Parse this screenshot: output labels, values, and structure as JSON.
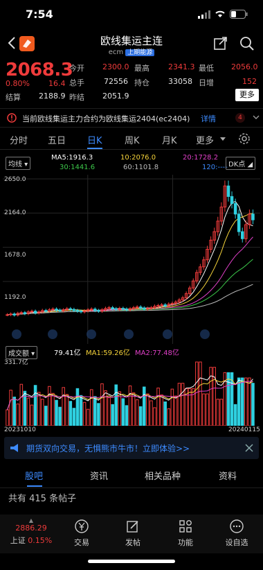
{
  "status": {
    "time": "7:54"
  },
  "header": {
    "title": "欧线集运主连",
    "code": "ecm",
    "exchange": "上期能源"
  },
  "quote": {
    "price": "2068.3",
    "change_pct": "0.80%",
    "change": "16.4",
    "open_label": "今开",
    "open": "2300.0",
    "high_label": "最高",
    "high": "2341.3",
    "low_label": "最低",
    "low": "2056.0",
    "volume_label": "总手",
    "volume": "72556",
    "oi_label": "持仓",
    "oi": "33058",
    "daily_add_label": "日增",
    "daily_add": "152",
    "settle_label": "结算",
    "settle": "2188.9",
    "prev_label": "昨结",
    "prev": "2051.9",
    "more_label": "更多"
  },
  "notice": {
    "text": "当前欧线集运主力合约为欧线集运2404(ec2404)",
    "link": "详情",
    "badge": "4"
  },
  "period_tabs": [
    "分时",
    "五日",
    "日K",
    "周K",
    "月K",
    "更多"
  ],
  "active_tab": "日K",
  "indicators": {
    "ma_select": "均线",
    "ma5": "MA5:1916.3",
    "ma10": "10:2076.0",
    "ma20": "20:1728.2",
    "ma30": "30:1441.6",
    "ma60": "60:1101.8",
    "ma120": "120:----",
    "dk": "DK点"
  },
  "price_axis": [
    "2650.0",
    "2164.0",
    "1678.0",
    "1192.0"
  ],
  "volume_header": {
    "select": "成交额",
    "val": "79.41亿",
    "ma1": "MA1:59.26亿",
    "ma2": "MA2:77.48亿",
    "max": "331.7亿"
  },
  "dates": {
    "start": "20231010",
    "end": "20240115"
  },
  "promo": {
    "text": "期货双向交易，无惧熊市牛市！立即体验>>"
  },
  "bottom_tabs": [
    "股吧",
    "资讯",
    "相关品种",
    "资料"
  ],
  "posts": {
    "text": "共有 415 条帖子"
  },
  "index": {
    "value": "2886.29",
    "name": "上证",
    "pct": "0.15%"
  },
  "nav": [
    "交易",
    "发帖",
    "功能",
    "设自选"
  ],
  "colors": {
    "up": "#ef3b3b",
    "down": "#2fd0e0",
    "accent": "#3d8bff",
    "ma5": "#ffffff",
    "ma10": "#f5d33a",
    "ma20": "#e040c8",
    "ma30": "#3cc84a",
    "ma60": "#bbbbbb"
  },
  "chart_data": {
    "type": "candlestick",
    "ylim": [
      600,
      2650
    ],
    "y_ticks": [
      2650.0,
      2164.0,
      1678.0,
      1192.0
    ],
    "x_range": [
      "20231010",
      "20240115"
    ],
    "ma_last": {
      "MA5": 1916.3,
      "MA10": 2076.0,
      "MA20": 1728.2,
      "MA30": 1441.6,
      "MA60": 1101.8
    },
    "closes": [
      720,
      730,
      715,
      740,
      750,
      735,
      760,
      770,
      745,
      760,
      780,
      770,
      790,
      800,
      785,
      775,
      790,
      805,
      795,
      780,
      770,
      760,
      775,
      790,
      800,
      780,
      770,
      790,
      810,
      820,
      805,
      795,
      810,
      800,
      790,
      805,
      820,
      830,
      815,
      800,
      810,
      820,
      840,
      850,
      860,
      845,
      870,
      880,
      900,
      930,
      960,
      1020,
      1100,
      1200,
      1320,
      1400,
      1500,
      1650,
      1780,
      1900,
      2050,
      2250,
      2550,
      2400,
      2300,
      2150,
      1900,
      1800,
      2000,
      2150,
      2068
    ],
    "volume": {
      "last": "79.41亿",
      "max": "331.7亿",
      "ma1": "59.26亿",
      "ma2": "77.48亿"
    }
  }
}
